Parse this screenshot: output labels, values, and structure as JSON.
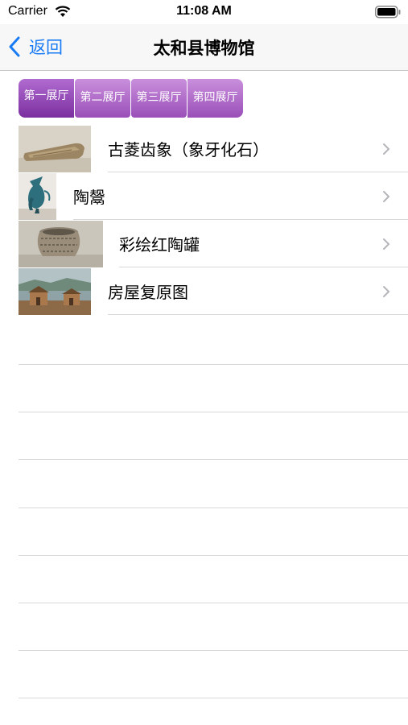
{
  "status": {
    "carrier": "Carrier",
    "time": "11:08 AM"
  },
  "nav": {
    "back_label": "返回",
    "title": "太和县博物馆"
  },
  "halls": [
    {
      "label": "第一展厅",
      "selected": true
    },
    {
      "label": "第二展厅",
      "selected": false
    },
    {
      "label": "第三展厅",
      "selected": false
    },
    {
      "label": "第四展厅",
      "selected": false
    }
  ],
  "exhibits": [
    {
      "name": "古菱齿象（象牙化石）",
      "thumbnail": "ivory-fossil-photo"
    },
    {
      "name": "陶鬶",
      "thumbnail": "pottery-vessel-photo"
    },
    {
      "name": "彩绘红陶罐",
      "thumbnail": "painted-jar-photo"
    },
    {
      "name": "房屋复原图",
      "thumbnail": "house-restoration-photo"
    }
  ],
  "colors": {
    "tint": "#1a7cf5",
    "tab": "#9a4fb8",
    "separator": "#d8d8d8"
  }
}
